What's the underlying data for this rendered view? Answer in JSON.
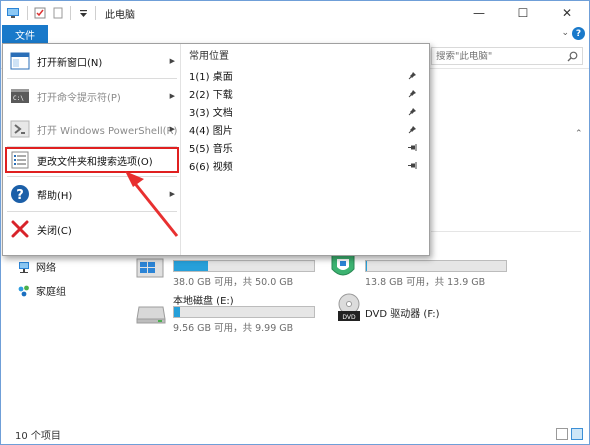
{
  "window": {
    "title": "此电脑",
    "controls": {
      "minimize": "—",
      "maximize": "☐",
      "close": "✕"
    }
  },
  "ribbon": {
    "file_tab": "文件",
    "help_icon": "?"
  },
  "search": {
    "placeholder": "搜索\"此电脑\""
  },
  "file_menu": {
    "items": [
      {
        "label": "打开新窗口(N)",
        "icon": "new-window-icon",
        "enabled": true,
        "submenu": true
      },
      {
        "label": "打开命令提示符(P)",
        "icon": "command-prompt-icon",
        "enabled": false,
        "submenu": true
      },
      {
        "label": "打开 Windows PowerShell(R)",
        "icon": "powershell-icon",
        "enabled": false,
        "submenu": true
      },
      {
        "label": "更改文件夹和搜索选项(O)",
        "icon": "folder-options-icon",
        "enabled": true,
        "submenu": false,
        "highlighted": true
      },
      {
        "label": "帮助(H)",
        "icon": "help-icon",
        "enabled": true,
        "submenu": true
      },
      {
        "label": "关闭(C)",
        "icon": "close-icon",
        "enabled": true,
        "submenu": false
      }
    ],
    "frequent_title": "常用位置",
    "frequent": [
      {
        "label": "1(1)  桌面",
        "pin": "pinned"
      },
      {
        "label": "2(2)  下载",
        "pin": "pinned"
      },
      {
        "label": "3(3)  文档",
        "pin": "pinned"
      },
      {
        "label": "4(4)  图片",
        "pin": "pinned"
      },
      {
        "label": "5(5)  音乐",
        "pin": "unpinned"
      },
      {
        "label": "6(6)  视频",
        "pin": "unpinned"
      }
    ]
  },
  "nav": {
    "network": "网络",
    "homegroup": "家庭组"
  },
  "drives": [
    {
      "name": "",
      "info": "38.0 GB 可用，共 50.0 GB",
      "used_fraction": 0.24
    },
    {
      "name": "",
      "info": "13.8 GB 可用，共 13.9 GB",
      "used_fraction": 0.01
    },
    {
      "name": "本地磁盘 (E:)",
      "info": "9.56 GB 可用，共 9.99 GB",
      "used_fraction": 0.04
    },
    {
      "name": "DVD 驱动器 (F:)",
      "info": "",
      "used_fraction": 0
    }
  ],
  "status": {
    "item_count": "10 个项目"
  },
  "colors": {
    "accent": "#1979ca",
    "highlight_box": "#e02020",
    "drive_bar": "#26a0da"
  }
}
